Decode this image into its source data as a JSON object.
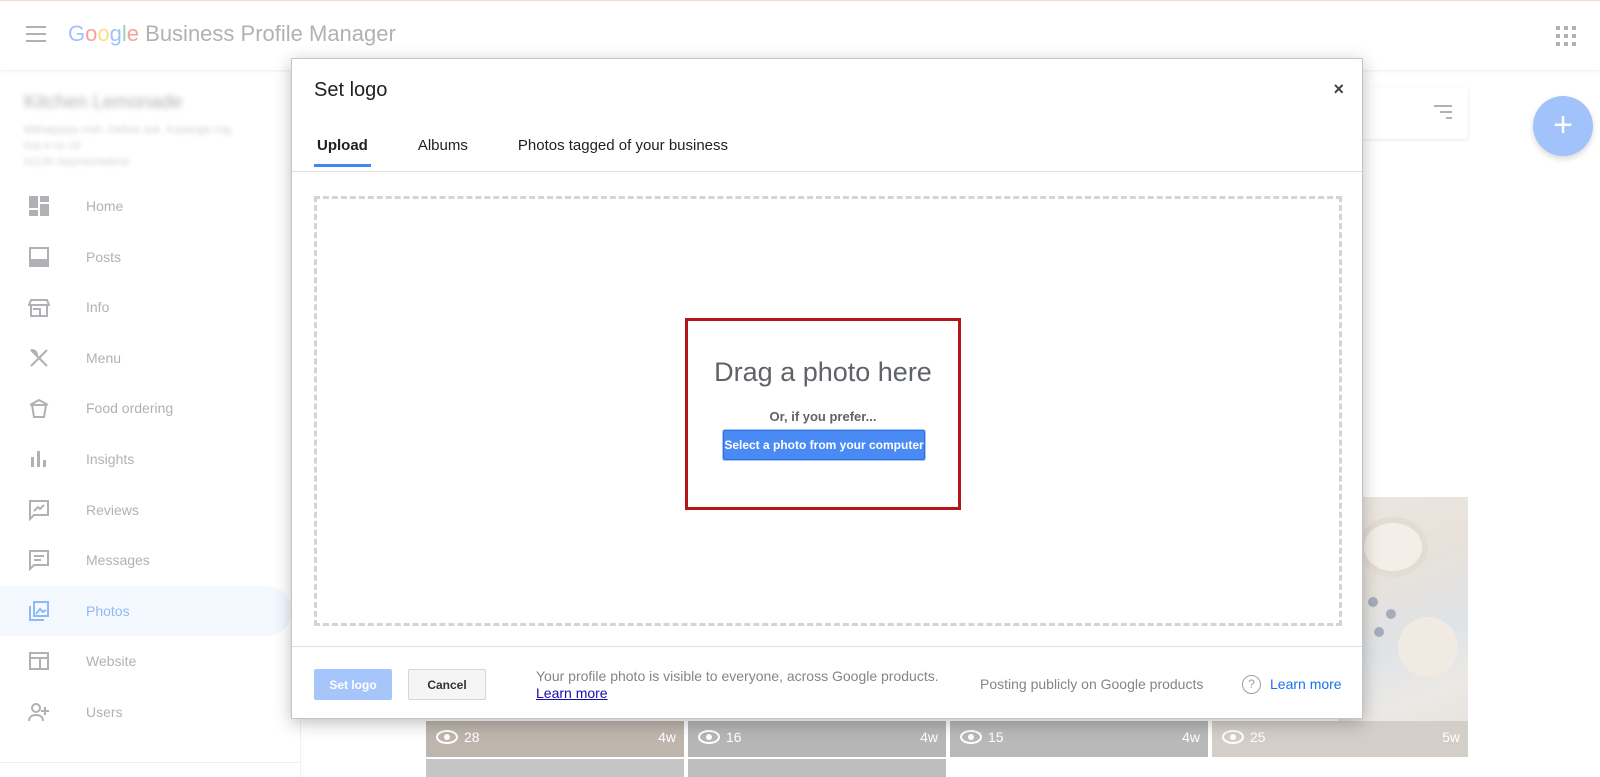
{
  "header": {
    "brand_google": [
      "G",
      "o",
      "o",
      "g",
      "l",
      "e"
    ],
    "brand_google_colors": [
      "#4285f4",
      "#ea4335",
      "#fbbc05",
      "#4285f4",
      "#34a853",
      "#ea4335"
    ],
    "brand_rest": "Business Profile Manager"
  },
  "business": {
    "name": "Kitchen Lemonade",
    "address_line1": "Mithatpaşa mah. Define sok. Kasaoglu Ing.",
    "address_line2": "Kat 4 no 19",
    "address_line3": "01130 Seyhan/Adana"
  },
  "sidebar": {
    "items": [
      {
        "label": "Home",
        "icon": "dashboard-icon"
      },
      {
        "label": "Posts",
        "icon": "posts-icon"
      },
      {
        "label": "Info",
        "icon": "store-icon"
      },
      {
        "label": "Menu",
        "icon": "fork-knife-icon"
      },
      {
        "label": "Food ordering",
        "icon": "takeout-icon"
      },
      {
        "label": "Insights",
        "icon": "bar-chart-icon"
      },
      {
        "label": "Reviews",
        "icon": "rate-review-icon"
      },
      {
        "label": "Messages",
        "icon": "message-icon"
      },
      {
        "label": "Photos",
        "icon": "photo-library-icon",
        "active": true
      },
      {
        "label": "Website",
        "icon": "web-icon"
      },
      {
        "label": "Users",
        "icon": "person-add-icon"
      }
    ]
  },
  "photos": {
    "thumbs": [
      {
        "views": "28",
        "age": "4w"
      },
      {
        "views": "16",
        "age": "4w"
      },
      {
        "views": "15",
        "age": "4w"
      },
      {
        "views": "25",
        "age": "5w"
      }
    ]
  },
  "fab_label": "+",
  "dialog": {
    "title": "Set logo",
    "close": "×",
    "tabs": [
      "Upload",
      "Albums",
      "Photos tagged of your business"
    ],
    "active_tab": "Upload",
    "drag_text": "Drag a photo here",
    "or_text": "Or, if you prefer...",
    "select_button": "Select a photo from your computer",
    "set_logo_button": "Set logo",
    "cancel_button": "Cancel",
    "visibility_text": "Your profile photo is visible to everyone, across Google products.",
    "learn_more": "Learn more",
    "posting_text": "Posting publicly on Google products",
    "help_glyph": "?",
    "learn_more_2": "Learn more"
  },
  "colors": {
    "accent": "#4285f4",
    "highlight": "#b3151d",
    "active_nav_bg": "#e8f0fe"
  }
}
